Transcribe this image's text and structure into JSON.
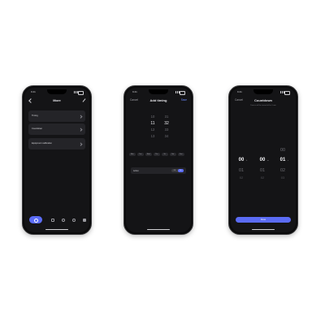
{
  "colors": {
    "accent": "#5b6cf5",
    "background": "#141416",
    "card": "#242428"
  },
  "phone1": {
    "status_time": "9:41",
    "title": "More",
    "back_icon": "chevron-left-icon",
    "edit_icon": "pencil-icon",
    "menu": [
      {
        "label": "Timing"
      },
      {
        "label": "Countdown"
      },
      {
        "label": "Equipment calibration"
      }
    ],
    "tabbar_icons": [
      "power-icon",
      "stats-icon",
      "bulb-icon",
      "settings-icon",
      "grid-icon"
    ]
  },
  "phone2": {
    "status_time": "9:41",
    "cancel": "Cancel",
    "title": "Add timing",
    "save": "Save",
    "hours": [
      "10",
      "11",
      "12",
      "13"
    ],
    "minutes": [
      "31",
      "32",
      "33",
      "34"
    ],
    "days": [
      "Mon",
      "Tue",
      "Wed",
      "Thu",
      "Fri",
      "Sat",
      "Sun"
    ],
    "repeat_label": "Action",
    "toggle_off": "Off",
    "toggle_on": "On"
  },
  "phone3": {
    "status_time": "9:41",
    "cancel": "Cancel",
    "title": "Countdown",
    "subtitle": "Device will be turned off in 0 min",
    "top_value": "00",
    "selected": [
      "00",
      "00",
      "01"
    ],
    "units": [
      "h",
      "m",
      "s"
    ],
    "next": [
      "01",
      "01",
      "02"
    ],
    "after": [
      "02",
      "02",
      "03"
    ],
    "done": "Done"
  }
}
